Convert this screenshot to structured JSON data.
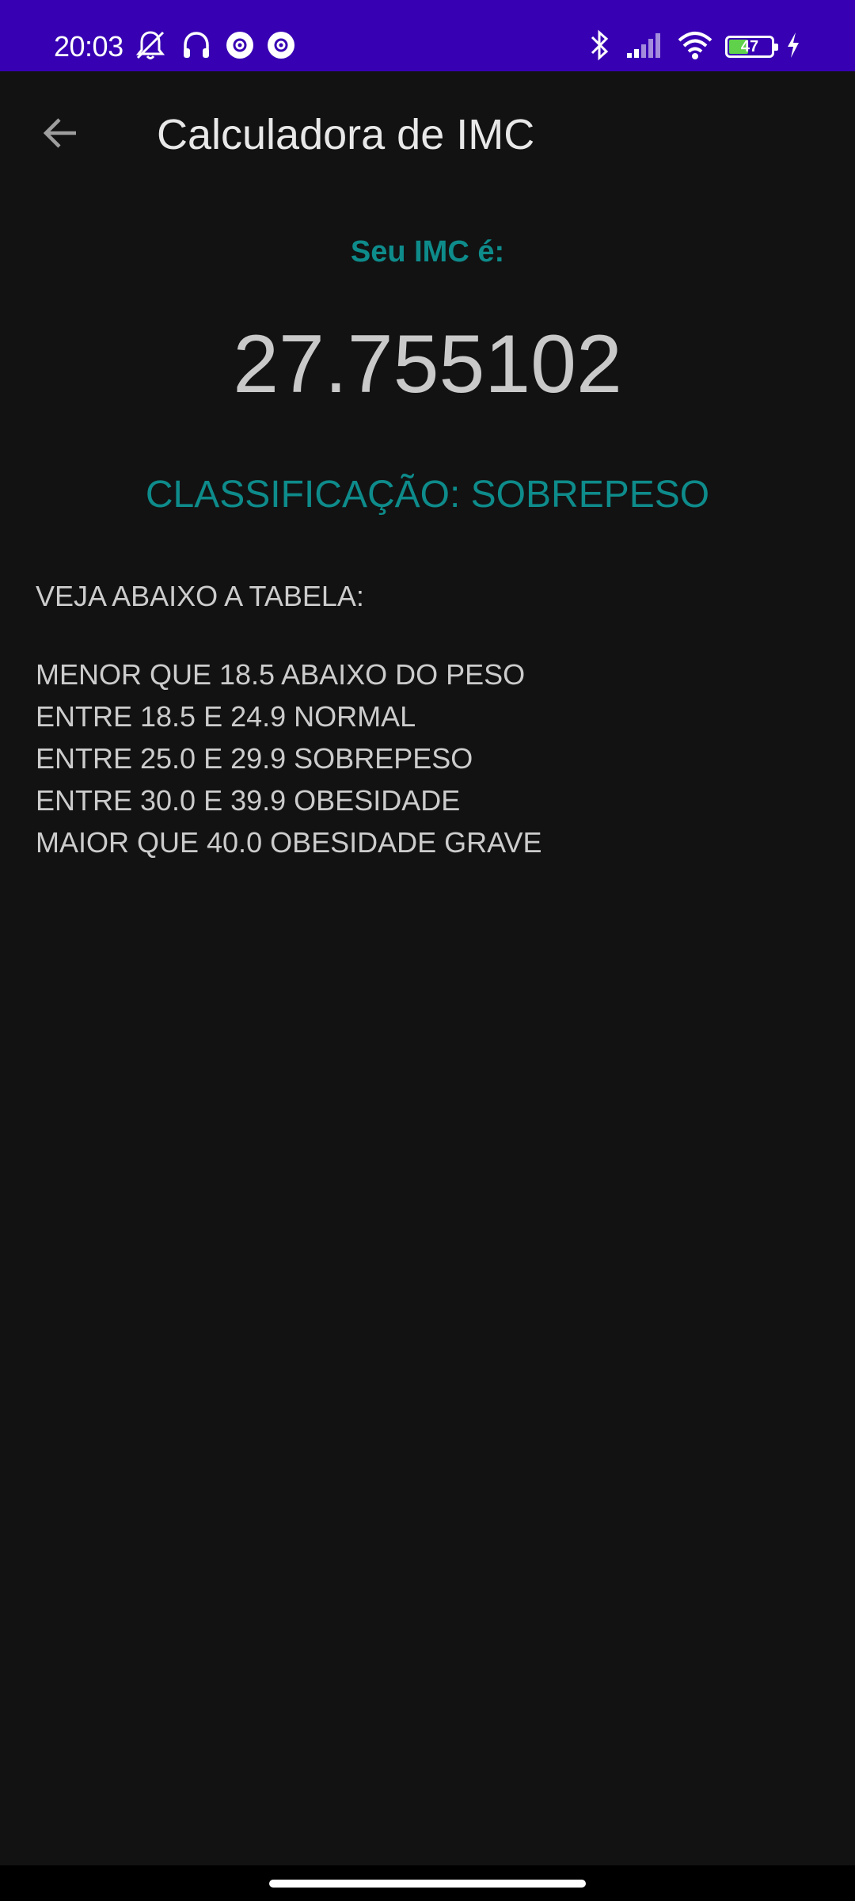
{
  "status_bar": {
    "time": "20:03",
    "left_icons": [
      "mute-icon",
      "headphones-icon",
      "app-notification-icon",
      "app-notification-icon"
    ],
    "right_icons": [
      "bluetooth-icon",
      "signal-icon",
      "wifi-icon"
    ],
    "battery_level": "47",
    "battery_percent": 47,
    "charging": true,
    "background_color": "#3700b3"
  },
  "app_bar": {
    "back_icon": "arrow-back-icon",
    "title": "Calculadora de IMC"
  },
  "result": {
    "label": "Seu IMC é:",
    "value": "27.755102",
    "classification": "CLASSIFICAÇÃO: SOBREPESO",
    "accent_color": "#0e8b8b"
  },
  "reference": {
    "heading": "VEJA ABAIXO A TABELA:",
    "rows": [
      "MENOR QUE 18.5 ABAIXO DO PESO",
      "ENTRE 18.5 E 24.9 NORMAL",
      "ENTRE 25.0 E 29.9 SOBREPESO",
      "ENTRE 30.0 E 39.9 OBESIDADE",
      "MAIOR QUE 40.0 OBESIDADE GRAVE"
    ]
  },
  "theme": {
    "background": "#121212",
    "text": "#cccccc"
  }
}
